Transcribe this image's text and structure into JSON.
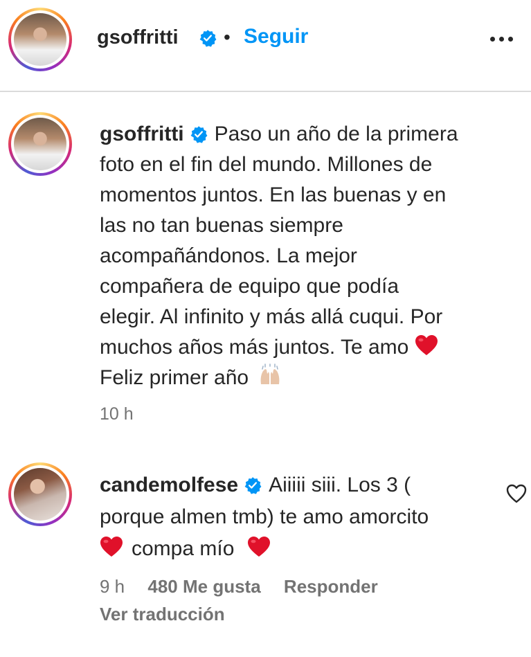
{
  "header": {
    "username": "gsoffritti",
    "separator": "•",
    "follow_label": "Seguir",
    "more_icon": "more-horizontal-icon"
  },
  "caption": {
    "username": "gsoffritti",
    "line_1": "Paso un año de la primera",
    "line_2": "foto en el fin del mundo. Millones de",
    "line_3": "momentos juntos. En las buenas y en",
    "line_4": "las no tan buenas siempre",
    "line_5": "acompañándonos. La mejor",
    "line_6": "compañera de equipo que podía",
    "line_7": "elegir. Al infinito y más allá cuqui. Por",
    "line_8": "muchos años más juntos. Te amo",
    "line_9": "Feliz primer año",
    "timestamp": "10 h"
  },
  "comment": {
    "username": "candemolfese",
    "line_1": "Aiiiii siii. Los 3 (",
    "line_2": "porque almen tmb) te amo amorcito",
    "line_3": "compa mío",
    "timestamp": "9 h",
    "likes": "480 Me gusta",
    "reply_label": "Responder",
    "translate_label": "Ver traducción"
  },
  "colors": {
    "link_blue": "#0095f6",
    "verified_blue": "#0095f6",
    "heart_red": "#e0112a",
    "muted": "#737373"
  }
}
